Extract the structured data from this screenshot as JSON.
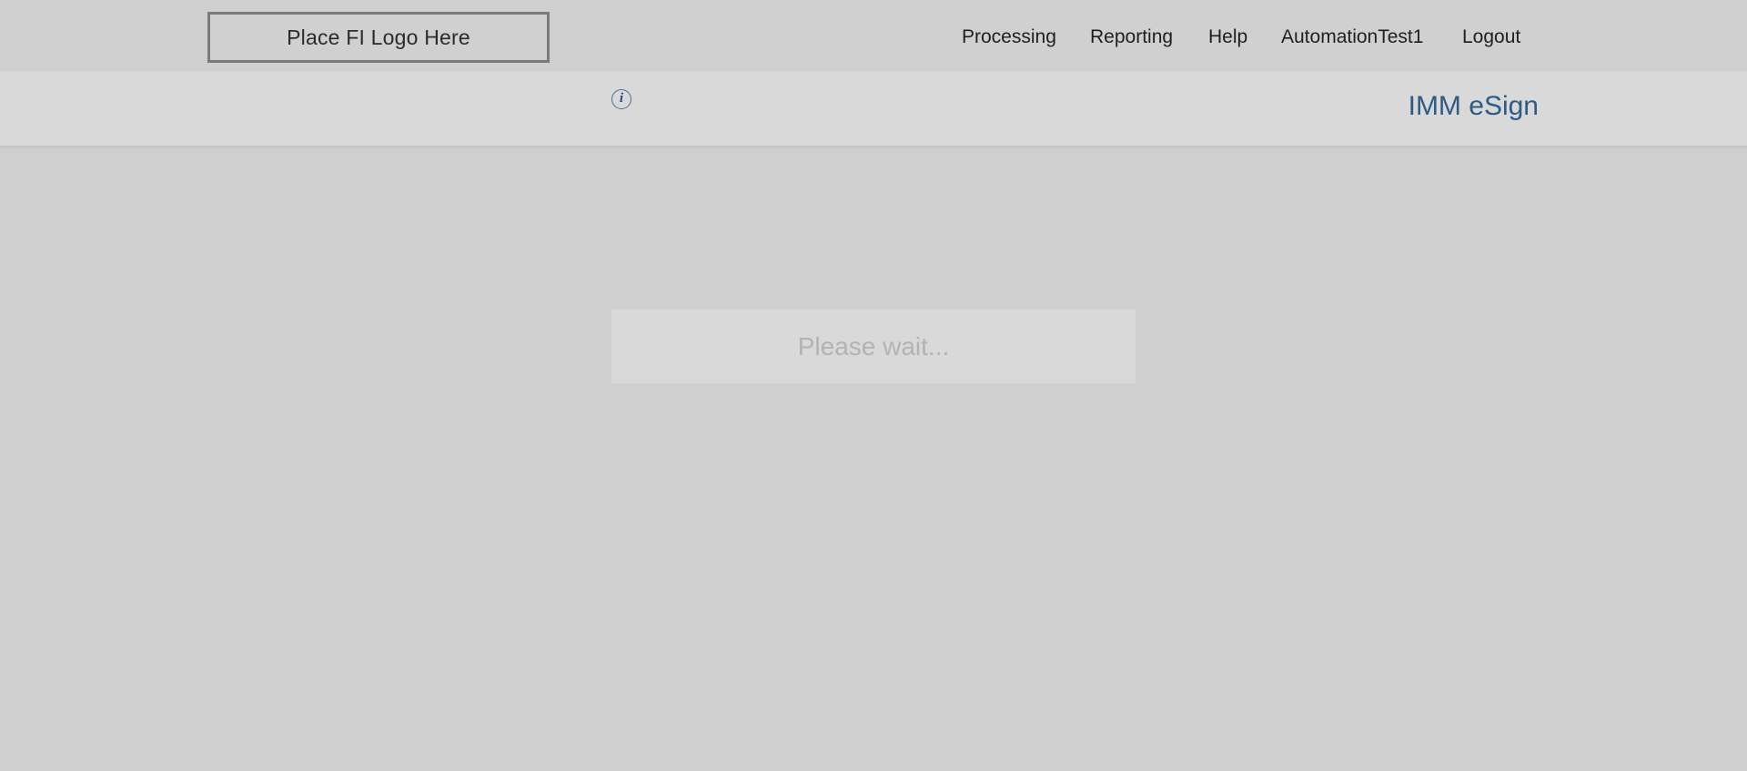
{
  "header": {
    "logo_text": "Place FI Logo Here",
    "nav": [
      {
        "label": "Processing"
      },
      {
        "label": "Reporting"
      },
      {
        "label": "Help"
      },
      {
        "label": "AutomationTest1"
      },
      {
        "label": "Logout"
      }
    ]
  },
  "subheader": {
    "info_icon": "info-icon",
    "app_title": "IMM eSign"
  },
  "main": {
    "loading_text": "Please wait..."
  },
  "colors": {
    "background": "#cfcfcf",
    "subheader_background": "#d9d9d9",
    "accent": "#2c5b86"
  }
}
